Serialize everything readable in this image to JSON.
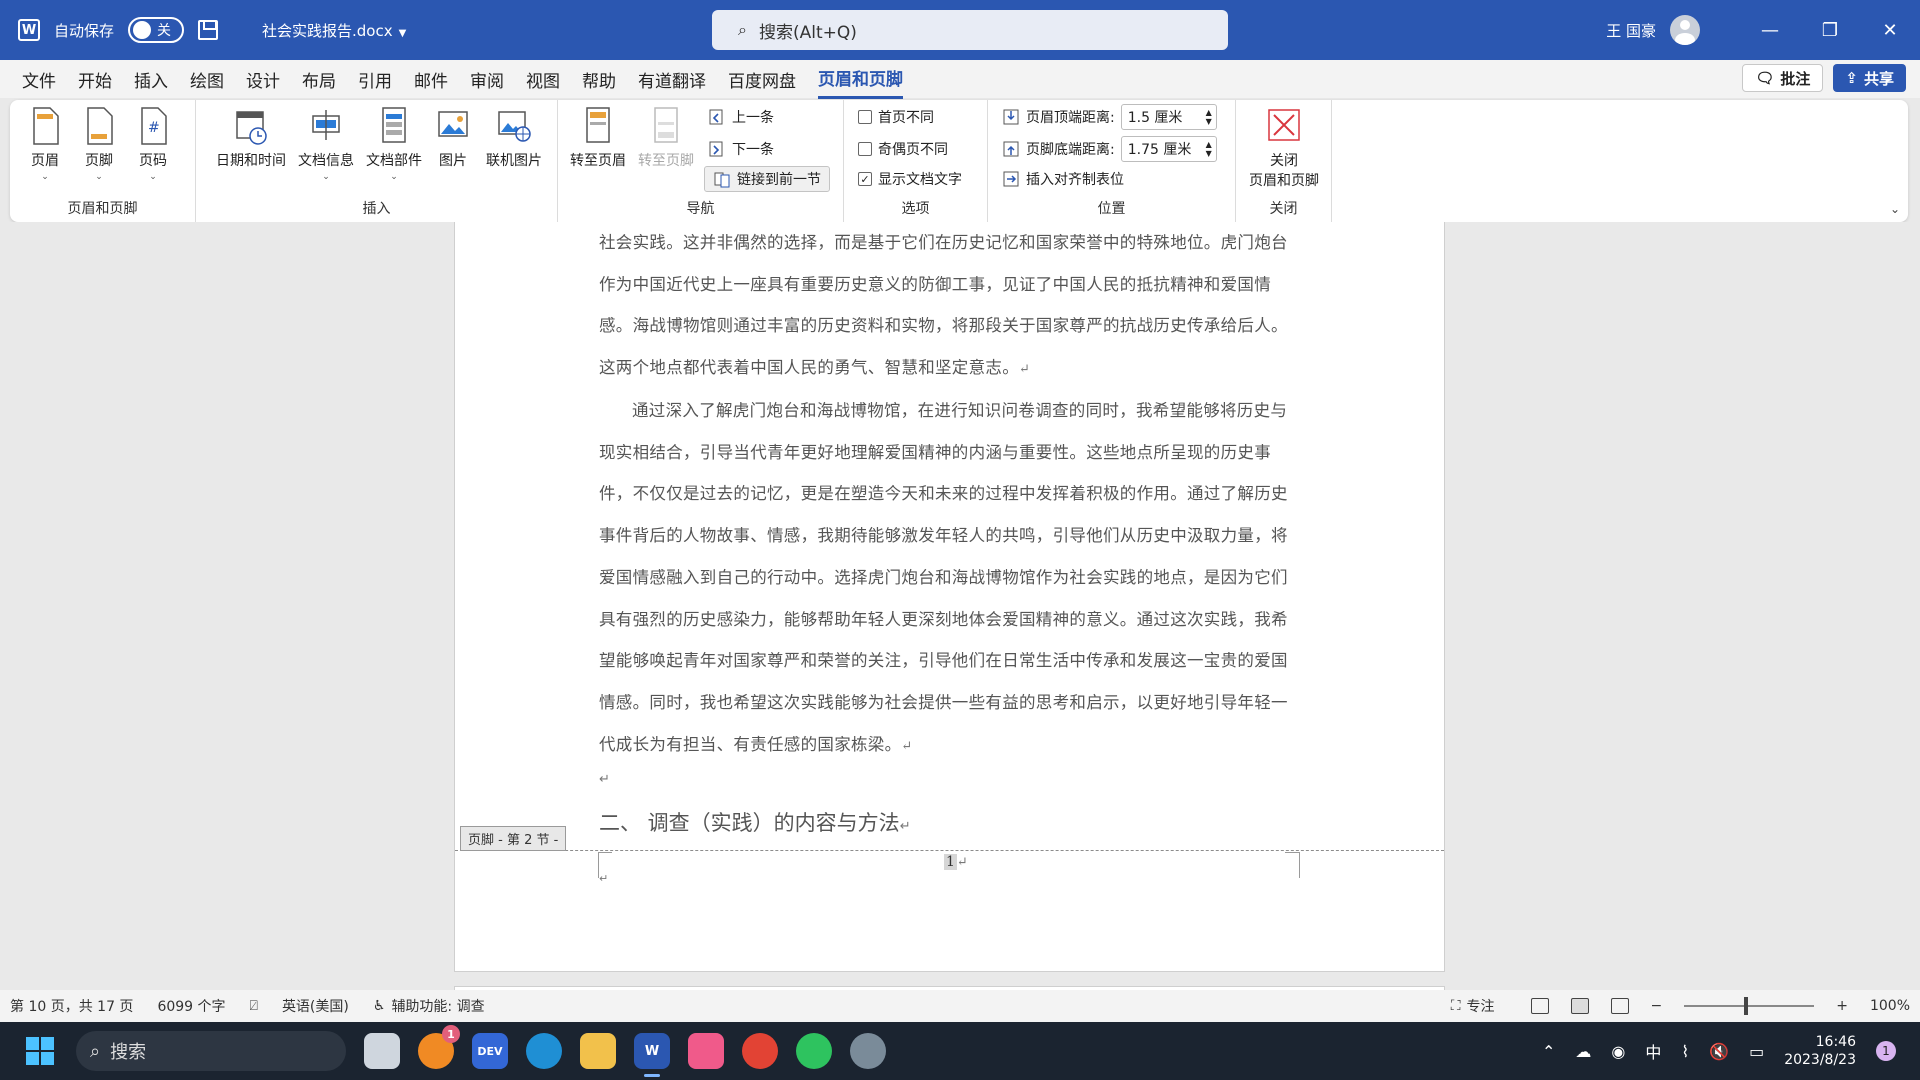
{
  "titlebar": {
    "app_icon": "W",
    "autosave_label": "自动保存",
    "autosave_state": "关",
    "doc_name": "社会实践报告.docx",
    "search_placeholder": "搜索(Alt+Q)",
    "user_name": "王 国豪",
    "minimize": "—",
    "restore": "❐",
    "close": "✕"
  },
  "menu": {
    "tabs": [
      "文件",
      "开始",
      "插入",
      "绘图",
      "设计",
      "布局",
      "引用",
      "邮件",
      "审阅",
      "视图",
      "帮助",
      "有道翻译",
      "百度网盘",
      "页眉和页脚"
    ],
    "active": "页眉和页脚",
    "comment_label": "批注",
    "share_label": "共享"
  },
  "ribbon": {
    "group_header_footer": {
      "label": "页眉和页脚",
      "buttons": [
        "页眉",
        "页脚",
        "页码"
      ]
    },
    "group_insert": {
      "label": "插入",
      "buttons": [
        "日期和时间",
        "文档信息",
        "文档部件",
        "图片",
        "联机图片"
      ]
    },
    "group_nav": {
      "label": "导航",
      "goto_header": "转至页眉",
      "goto_footer": "转至页脚",
      "prev": "上一条",
      "next": "下一条",
      "link_prev": "链接到前一节"
    },
    "group_options": {
      "label": "选项",
      "first_page": "首页不同",
      "odd_even": "奇偶页不同",
      "show_doc_text": "显示文档文字",
      "first_page_checked": false,
      "odd_even_checked": false,
      "show_doc_text_checked": true
    },
    "group_position": {
      "label": "位置",
      "header_top_label": "页眉顶端距离:",
      "header_top_value": "1.5 厘米",
      "footer_bottom_label": "页脚底端距离:",
      "footer_bottom_value": "1.75 厘米",
      "insert_align_tab": "插入对齐制表位"
    },
    "group_close": {
      "label": "关闭",
      "close_btn_line1": "关闭",
      "close_btn_line2": "页眉和页脚"
    }
  },
  "document": {
    "p1": "社会实践。这并非偶然的选择，而是基于它们在历史记忆和国家荣誉中的特殊地位。虎门炮台作为中国近代史上一座具有重要历史意义的防御工事，见证了中国人民的抵抗精神和爱国情感。海战博物馆则通过丰富的历史资料和实物，将那段关于国家尊严的抗战历史传承给后人。这两个地点都代表着中国人民的勇气、智慧和坚定意志。",
    "p2": "通过深入了解虎门炮台和海战博物馆，在进行知识问卷调查的同时，我希望能够将历史与现实相结合，引导当代青年更好地理解爱国精神的内涵与重要性。这些地点所呈现的历史事件，不仅仅是过去的记忆，更是在塑造今天和未来的过程中发挥着积极的作用。通过了解历史事件背后的人物故事、情感，我期待能够激发年轻人的共鸣，引导他们从历史中汲取力量，将爱国情感融入到自己的行动中。选择虎门炮台和海战博物馆作为社会实践的地点，是因为它们具有强烈的历史感染力，能够帮助年轻人更深刻地体会爱国精神的意义。通过这次实践，我希望能够唤起青年对国家尊严和荣誉的关注，引导他们在日常生活中传承和发展这一宝贵的爱国情感。同时，我也希望这次实践能够为社会提供一些有益的思考和启示，以更好地引导年轻一代成长为有担当、有责任感的国家栋梁。",
    "para_mark": "↵",
    "heading": "二、    调查（实践）的内容与方法",
    "footer_tag": "页脚 - 第 2 节 -",
    "footer_page_num": "1"
  },
  "statusbar": {
    "page_info": "第 10 页，共 17 页",
    "word_count": "6099 个字",
    "language": "英语(美国)",
    "accessibility": "辅助功能: 调查",
    "focus": "专注",
    "zoom": "100%",
    "zoom_level": 1.0
  },
  "taskbar": {
    "search_label": "搜索",
    "badge_count": "1",
    "ime": "中",
    "time": "16:46",
    "date": "2023/8/23",
    "notification_count": "1"
  }
}
